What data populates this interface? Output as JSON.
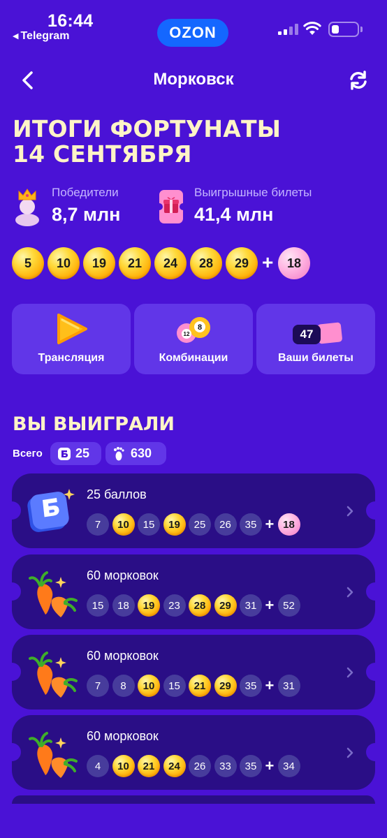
{
  "status_bar": {
    "time": "16:44",
    "back_app": "Telegram",
    "brand": "OZON"
  },
  "nav": {
    "title": "Морковск"
  },
  "headline": {
    "line1": "ИТОГИ ФОРТУНАТЫ",
    "line2": "14 СЕНТЯБРЯ"
  },
  "stats": [
    {
      "label": "Победители",
      "value": "8,7 млн",
      "icon": "winner-crown-icon"
    },
    {
      "label": "Выигрышные билеты",
      "value": "41,4 млн",
      "icon": "gift-ticket-icon"
    }
  ],
  "winning_numbers": {
    "main": [
      "5",
      "10",
      "19",
      "21",
      "24",
      "28",
      "29"
    ],
    "plus": "+",
    "bonus": "18"
  },
  "actions": [
    {
      "label": "Трансляция",
      "icon": "play-icon"
    },
    {
      "label": "Комбинации",
      "icon": "lottery-balls-icon"
    },
    {
      "label": "Ваши билеты",
      "icon": "ticket-icon",
      "badge": "47"
    }
  ],
  "won": {
    "title": "ВЫ ВЫИГРАЛИ",
    "total_label": "Всего",
    "points": "25",
    "carrots": "630"
  },
  "prizes": [
    {
      "title": "25 баллов",
      "icon": "points-b-icon",
      "numbers": [
        {
          "n": "7",
          "hit": false
        },
        {
          "n": "10",
          "hit": true
        },
        {
          "n": "15",
          "hit": false
        },
        {
          "n": "19",
          "hit": true
        },
        {
          "n": "25",
          "hit": false
        },
        {
          "n": "26",
          "hit": false
        },
        {
          "n": "35",
          "hit": false
        }
      ],
      "bonus": {
        "n": "18",
        "hit": true
      }
    },
    {
      "title": "60 морковок",
      "icon": "carrot-icon",
      "numbers": [
        {
          "n": "15",
          "hit": false
        },
        {
          "n": "18",
          "hit": false
        },
        {
          "n": "19",
          "hit": true
        },
        {
          "n": "23",
          "hit": false
        },
        {
          "n": "28",
          "hit": true
        },
        {
          "n": "29",
          "hit": true
        },
        {
          "n": "31",
          "hit": false
        }
      ],
      "bonus": {
        "n": "52",
        "hit": false
      }
    },
    {
      "title": "60 морковок",
      "icon": "carrot-icon",
      "numbers": [
        {
          "n": "7",
          "hit": false
        },
        {
          "n": "8",
          "hit": false
        },
        {
          "n": "10",
          "hit": true
        },
        {
          "n": "15",
          "hit": false
        },
        {
          "n": "21",
          "hit": true
        },
        {
          "n": "29",
          "hit": true
        },
        {
          "n": "35",
          "hit": false
        }
      ],
      "bonus": {
        "n": "31",
        "hit": false
      }
    },
    {
      "title": "60 морковок",
      "icon": "carrot-icon",
      "numbers": [
        {
          "n": "4",
          "hit": false
        },
        {
          "n": "10",
          "hit": true
        },
        {
          "n": "21",
          "hit": true
        },
        {
          "n": "24",
          "hit": true
        },
        {
          "n": "26",
          "hit": false
        },
        {
          "n": "33",
          "hit": false
        },
        {
          "n": "35",
          "hit": false
        }
      ],
      "bonus": {
        "n": "34",
        "hit": false
      }
    }
  ],
  "colors": {
    "background": "#4a12d6",
    "card": "#6136e8",
    "prize_card": "#2a0e86",
    "headline": "#fff4c7",
    "brand_pill": "#1467ff"
  }
}
